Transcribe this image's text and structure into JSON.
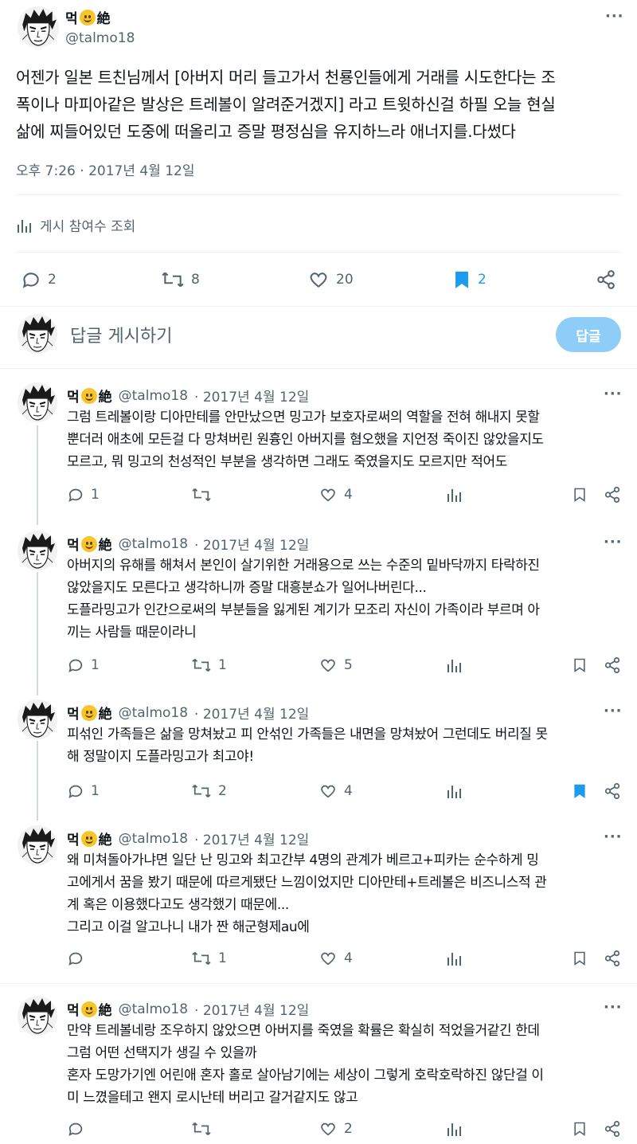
{
  "colors": {
    "accent": "#1d9bf0",
    "muted": "#536471",
    "text": "#0f1419",
    "reply_button": "#8ecdf8"
  },
  "main_tweet": {
    "display_name_prefix": "먹",
    "display_name_suffix": "絶",
    "handle": "@talmo18",
    "text_lines": [
      "어젠가 일본 트친님께서 [아버지 머리 들고가서 천룡인들에게 거래를 시도한다는 조",
      "폭이나 마피아같은 발상은 트레볼이 알려준거겠지] 라고 트윗하신걸 하필 오늘 현실",
      "삶에 찌들어있던 도중에 떠올리고 증말 평정심을 유지하느라 애너지를.다썼다"
    ],
    "timestamp": "오후 7:26 · 2017년 4월 12일",
    "views_label": "게시 참여수 조회",
    "stats": {
      "replies": "2",
      "retweets": "8",
      "likes": "20",
      "bookmarks": "2"
    }
  },
  "compose": {
    "placeholder": "답글 게시하기",
    "button_label": "답글"
  },
  "replies": [
    {
      "name_prefix": "먹",
      "name_suffix": "絶",
      "handle": "@talmo18",
      "date": "· 2017년 4월 12일",
      "lines": [
        "그럼 트레볼이랑 디아만테를 안만났으면 밍고가 보호자로써의 역할을 전혀 해내지 못할",
        "뿐더러 애초에 모든걸 다 망쳐버린 원흉인 아버지를 혐오했을 지언정 죽이진 않았을지도",
        "모르고, 뭐 밍고의 천성적인 부분을 생각하면 그래도 죽였을지도 모르지만 적어도"
      ],
      "replies": "1",
      "retweets": "",
      "likes": "4",
      "bookmarked": false
    },
    {
      "name_prefix": "먹",
      "name_suffix": "絶",
      "handle": "@talmo18",
      "date": "· 2017년 4월 12일",
      "lines": [
        "아버지의 유해를 해쳐서 본인이 살기위한 거래용으로 쓰는 수준의 밑바닥까지 타락하진",
        "않았을지도 모른다고 생각하니까 증말 대흥분쇼가 일어나버린다...",
        "도플라밍고가 인간으로써의 부분들을 잃게된 계기가 모조리 자신이 가족이라 부르며 아",
        "끼는 사람들 때문이라니"
      ],
      "replies": "1",
      "retweets": "1",
      "likes": "5",
      "bookmarked": false
    },
    {
      "name_prefix": "먹",
      "name_suffix": "絶",
      "handle": "@talmo18",
      "date": "· 2017년 4월 12일",
      "lines": [
        "피섞인 가족들은 삶을 망쳐놨고 피 안섞인 가족들은 내면을 망쳐놨어 그런데도 버리질 못",
        "해 정말이지 도플라밍고가 최고야!"
      ],
      "replies": "1",
      "retweets": "2",
      "likes": "4",
      "bookmarked": true
    },
    {
      "name_prefix": "먹",
      "name_suffix": "絶",
      "handle": "@talmo18",
      "date": "· 2017년 4월 12일",
      "lines": [
        "왜 미쳐돌아가냐면 일단 난 밍고와 최고간부 4명의 관계가 베르고+피카는 순수하게 밍",
        "고에게서 꿈을 봤기 때문에 따르게됐단 느낌이었지만 디아만테+트레볼은 비즈니스적 관",
        "계 혹은 이용했다고도 생각했기 때문에...",
        "그리고 이걸 알고나니 내가 짠 해군형제au에"
      ],
      "replies": "",
      "retweets": "1",
      "likes": "4",
      "bookmarked": false
    },
    {
      "name_prefix": "먹",
      "name_suffix": "絶",
      "handle": "@talmo18",
      "date": "· 2017년 4월 12일",
      "lines": [
        "만약 트레볼네랑 조우하지 않았으면 아버지를 죽였을 확률은 확실히 적었을거같긴 한데",
        "그럼 어떤 선택지가 생길 수 있을까",
        "혼자 도망가기엔 어린애 혼자 홀로 살아남기에는 세상이 그렇게 호락호락하진 않단걸 이",
        "미 느꼈을테고 왠지 로시난테 버리고 갈거같지도 않고"
      ],
      "replies": "",
      "retweets": "",
      "likes": "2",
      "bookmarked": false
    }
  ]
}
